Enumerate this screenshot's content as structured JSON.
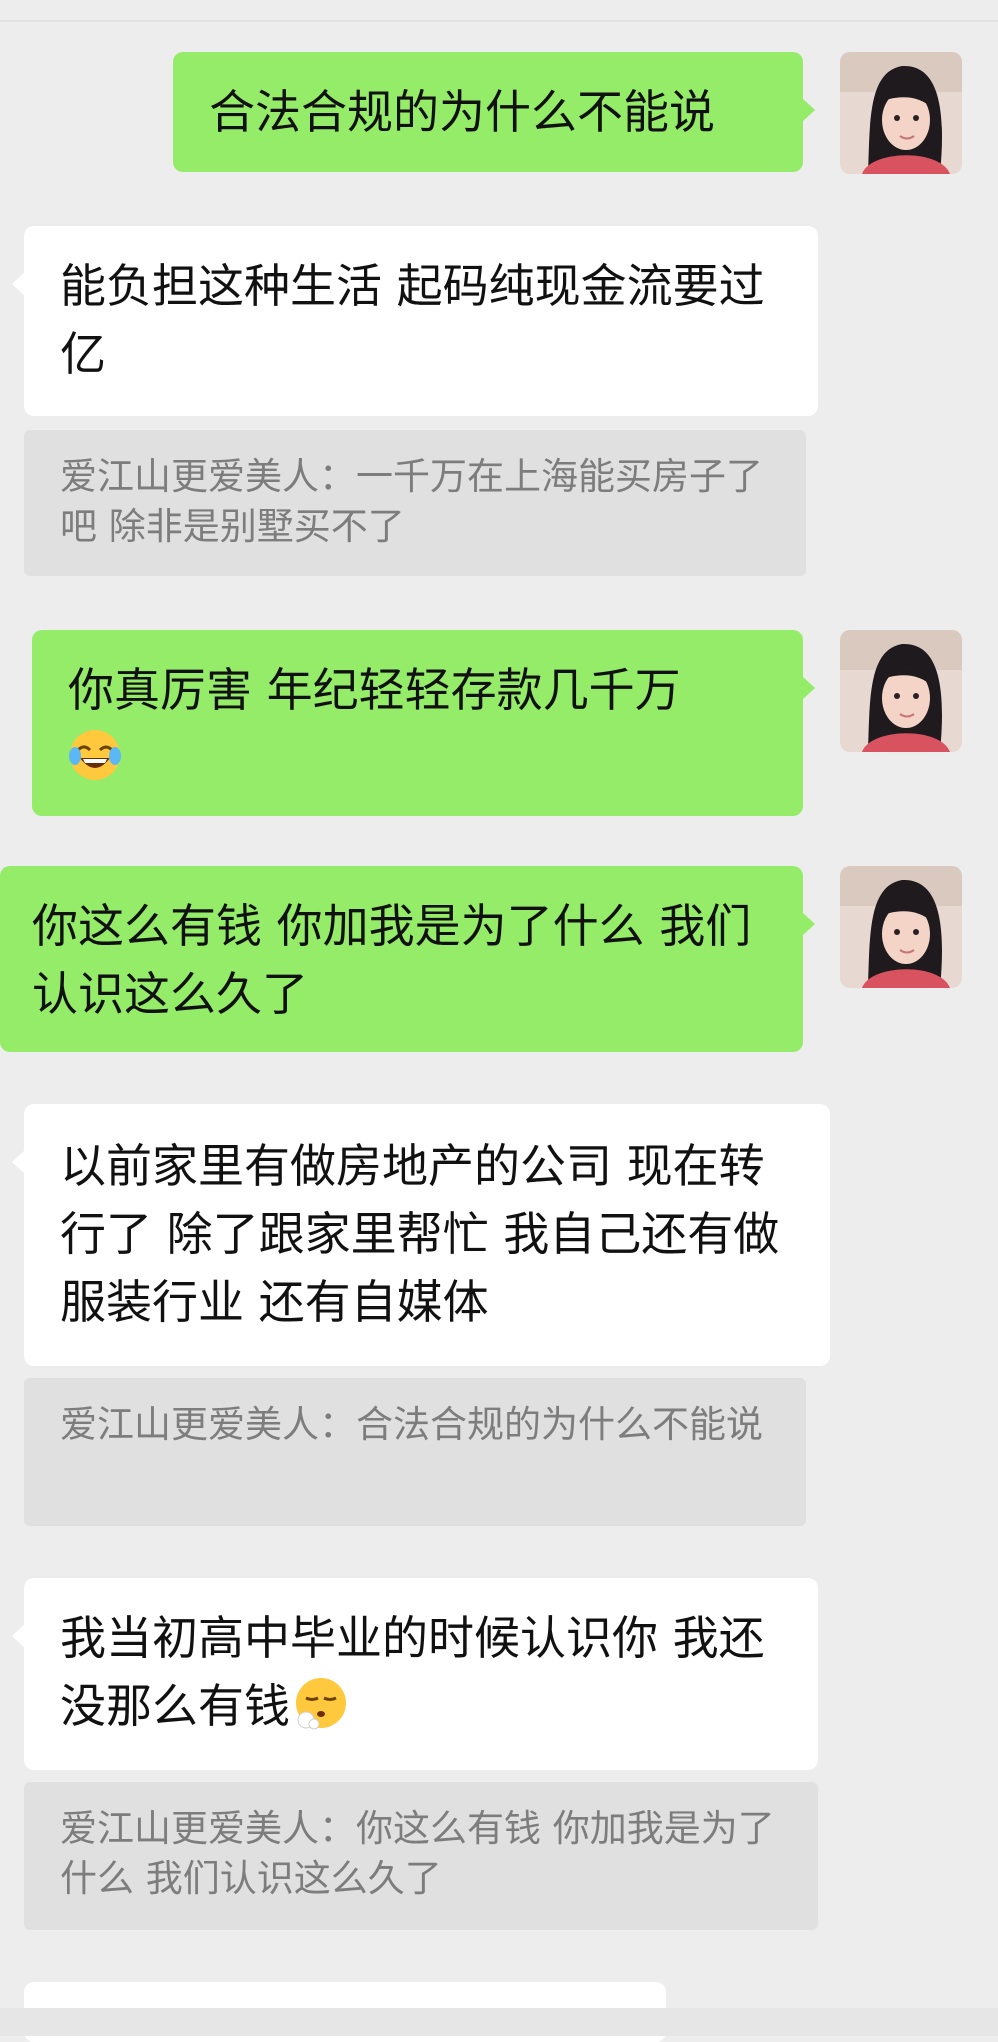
{
  "messages": [
    {
      "type": "sent",
      "text": "合法合规的为什么不能说"
    },
    {
      "type": "received",
      "text": "能负担这种生活 起码纯现金流要过亿"
    },
    {
      "type": "quote",
      "text": "爱江山更爱美人：一千万在上海能买房子了吧 除非是别墅买不了"
    },
    {
      "type": "sent",
      "text": "你真厉害  年纪轻轻存款几千万",
      "emoji": "laughing-crying-emoji"
    },
    {
      "type": "sent",
      "text": "你这么有钱 你加我是为了什么 我们认识这么久了"
    },
    {
      "type": "received",
      "text": "以前家里有做房地产的公司 现在转行了 除了跟家里帮忙 我自己还有做服装行业 还有自媒体"
    },
    {
      "type": "quote",
      "text": "爱江山更爱美人：合法合规的为什么不能说"
    },
    {
      "type": "received",
      "text": "我当初高中毕业的时候认识你 我还没那么有钱",
      "emoji": "sighing-emoji"
    },
    {
      "type": "quote",
      "text": "爱江山更爱美人：你这么有钱 你加我是为了什么 我们认识这么久了"
    }
  ],
  "colors": {
    "background": "#ededed",
    "sent_bubble": "#95ec69",
    "received_bubble": "#ffffff",
    "quote_background": "#e0e0e0",
    "quote_text": "#7d7d7d"
  }
}
